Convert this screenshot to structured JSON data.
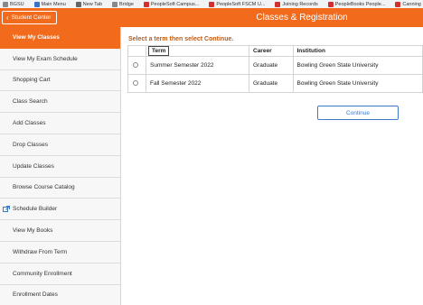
{
  "bookmarks": [
    {
      "label": "BGSU",
      "icon": "gray-square-icon"
    },
    {
      "label": "Main Menu",
      "icon": "blue-square-icon"
    },
    {
      "label": "New Tab",
      "icon": "globe-icon"
    },
    {
      "label": "Bridge",
      "icon": "grid-icon"
    },
    {
      "label": "PeopleSoft Campus...",
      "icon": "red-square-icon"
    },
    {
      "label": "PeopleSoft FSCM U...",
      "icon": "red-square-icon"
    },
    {
      "label": "Joining Records",
      "icon": "red-square-icon"
    },
    {
      "label": "PeopleBooks People...",
      "icon": "red-square-icon"
    },
    {
      "label": "Canning",
      "icon": "red-square-icon"
    }
  ],
  "header": {
    "back_label": "Student Center",
    "title": "Classes & Registration",
    "color": "#f26b1d"
  },
  "sidebar": {
    "items": [
      {
        "label": "View My Classes",
        "active": true
      },
      {
        "label": "View My Exam Schedule"
      },
      {
        "label": "Shopping Cart"
      },
      {
        "label": "Class Search"
      },
      {
        "label": "Add Classes"
      },
      {
        "label": "Drop Classes"
      },
      {
        "label": "Update Classes"
      },
      {
        "label": "Browse Course Catalog"
      },
      {
        "label": "Schedule Builder",
        "icon": "external-link-icon"
      },
      {
        "label": "View My Books"
      },
      {
        "label": "Withdraw From Term"
      },
      {
        "label": "Community Enrollment"
      },
      {
        "label": "Enrollment Dates"
      }
    ]
  },
  "main": {
    "instruction": "Select a term then select Continue.",
    "columns": [
      "Term",
      "Career",
      "Institution"
    ],
    "rows": [
      {
        "term": "Summer Semester 2022",
        "career": "Graduate",
        "institution": "Bowling Green State University"
      },
      {
        "term": "Fall Semester 2022",
        "career": "Graduate",
        "institution": "Bowling Green State University"
      }
    ],
    "continue_label": "Continue"
  }
}
